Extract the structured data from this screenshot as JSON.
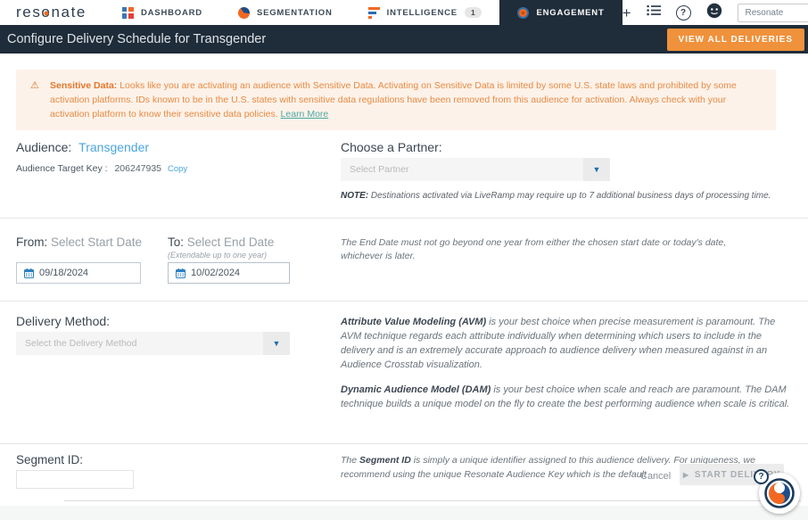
{
  "topnav": {
    "logo": "resonate",
    "items": [
      {
        "label": "DASHBOARD"
      },
      {
        "label": "SEGMENTATION"
      },
      {
        "label": "INTELLIGENCE",
        "badge": "1"
      },
      {
        "label": "ENGAGEMENT"
      }
    ],
    "account_select": "Resonate"
  },
  "header": {
    "title": "Configure Delivery Schedule for Transgender",
    "view_all_label": "VIEW ALL DELIVERIES"
  },
  "banner": {
    "lead": "Sensitive Data:",
    "body": "Looks like you are activating an audience with Sensitive Data. Activating on Sensitive Data is limited by some U.S. state laws and prohibited by some activation platforms. IDs known to be in the U.S. states with sensitive data regulations have been removed from this audience for activation. Always check with your activation platform to know their sensitive data policies.",
    "link": "Learn More"
  },
  "audience": {
    "label": "Audience:",
    "name": "Transgender",
    "key_label": "Audience Target Key :",
    "key_value": "206247935",
    "copy_label": "Copy"
  },
  "partner": {
    "label": "Choose a Partner:",
    "placeholder": "Select Partner",
    "note_lead": "NOTE:",
    "note_body": "Destinations activated via LiveRamp may require up to 7 additional business days of processing time."
  },
  "dates": {
    "from_label": "From:",
    "from_hint": "Select Start Date",
    "from_value": "09/18/2024",
    "to_label": "To:",
    "to_hint": "Select End Date",
    "to_sub": "(Extendable up to one year)",
    "to_value": "10/02/2024",
    "note": "The End Date must not go beyond one year from either the chosen start date or today's date, whichever is later."
  },
  "delivery_method": {
    "label": "Delivery Method:",
    "placeholder": "Select the Delivery Method",
    "avm_lead": "Attribute Value Modeling (AVM)",
    "avm_body": "is your best choice when precise measurement is paramount. The AVM technique regards each attribute individually when determining which users to include in the delivery and is an extremely accurate approach to audience delivery when measured against in an Audience Crosstab visualization.",
    "dam_lead": "Dynamic Audience Model (DAM)",
    "dam_body": "is your best choice when scale and reach are paramount. The DAM technique builds a unique model on the fly to create the best performing audience when scale is critical."
  },
  "segment": {
    "label": "Segment ID:",
    "note_pre": "The",
    "note_lead": "Segment ID",
    "note_body": "is simply a unique identifier assigned to this audience delivery. For uniqueness, we recommend using the unique Resonate Audience Key which is the default"
  },
  "actions": {
    "cancel_label": "Cancel",
    "start_label": "START DELIVERY"
  },
  "icons": {
    "caret_down": "▼",
    "play": "▶",
    "plus": "+",
    "help": "?",
    "warning": "⚠"
  },
  "colors": {
    "accent_orange": "#F0913B",
    "dark_navy": "#1F2C39",
    "link_blue": "#4AA6DD",
    "banner_text": "#E78A43",
    "learn_more_teal": "#4CA8A2"
  }
}
